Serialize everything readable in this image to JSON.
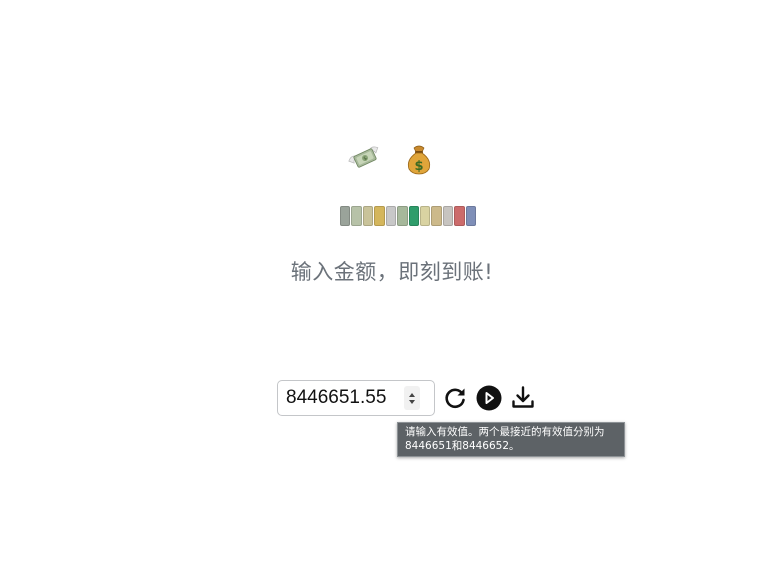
{
  "header": {
    "emojis": [
      "money-with-wings-icon",
      "money-bag-icon"
    ],
    "headline": "输入金额，即刻到账!"
  },
  "money_strip": {
    "colors": [
      "#9aa39a",
      "#b7c2a8",
      "#c9c39a",
      "#d4b65c",
      "#c8c8c8",
      "#a6b89b",
      "#2f9d6b",
      "#d9d3a2",
      "#ccb98a",
      "#c7c4c0",
      "#cc6b6b",
      "#7f8fb8"
    ]
  },
  "amount": {
    "value": "8446651.55"
  },
  "buttons": {
    "reset": "refresh-icon",
    "play": "play-circle-icon",
    "download": "download-icon"
  },
  "tooltip": {
    "line1": "请输入有效值。两个最接近的有效值分别为",
    "line2": "8446651和8446652。"
  }
}
